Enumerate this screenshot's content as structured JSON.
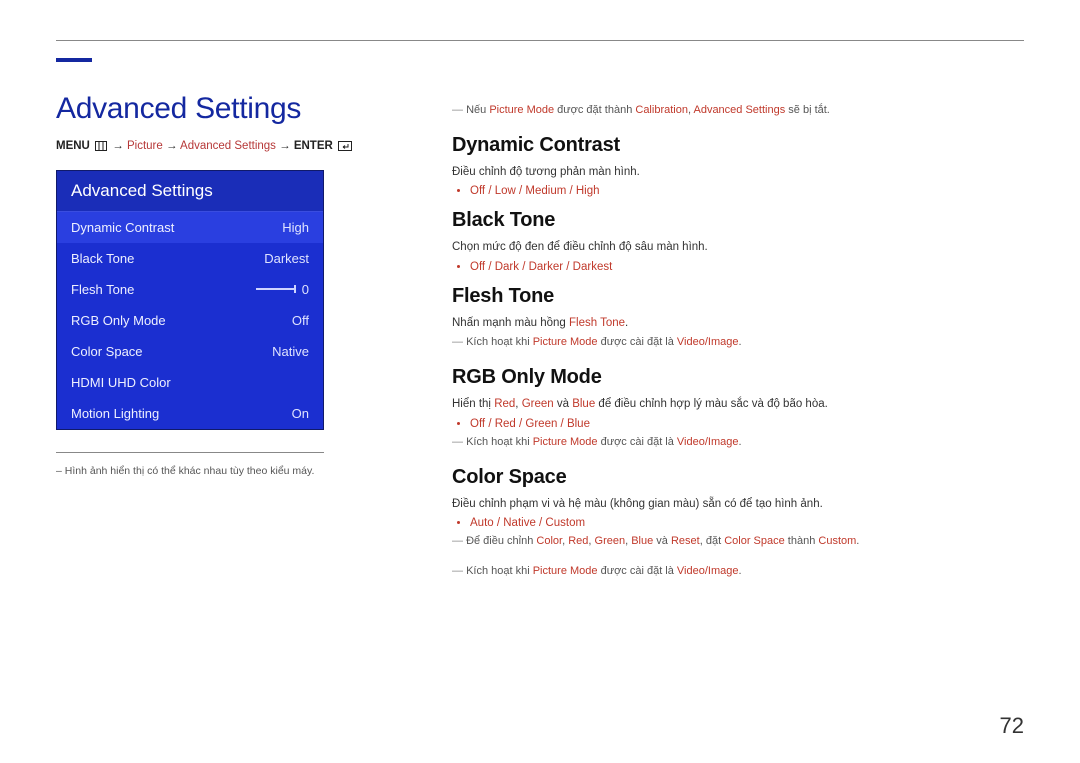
{
  "page_number": "72",
  "page_title": "Advanced Settings",
  "breadcrumb": {
    "prefix": "MENU",
    "picture": "Picture",
    "advanced": "Advanced Settings",
    "enter": "ENTER"
  },
  "menu": {
    "title": "Advanced Settings",
    "rows": [
      {
        "label": "Dynamic Contrast",
        "value": "High",
        "selected": true
      },
      {
        "label": "Black Tone",
        "value": "Darkest"
      },
      {
        "label": "Flesh Tone",
        "value": "0",
        "slider": true
      },
      {
        "label": "RGB Only Mode",
        "value": "Off"
      },
      {
        "label": "Color Space",
        "value": "Native"
      },
      {
        "label": "HDMI UHD Color",
        "value": ""
      },
      {
        "label": "Motion Lighting",
        "value": "On"
      }
    ]
  },
  "caption": "– Hình ảnh hiển thị có thể khác nhau tùy theo kiểu máy.",
  "topnote": {
    "pre": "Nếu ",
    "pm": "Picture Mode",
    "mid": " được đặt thành ",
    "cal": "Calibration",
    "mid2": ", ",
    "as": "Advanced Settings",
    "post": " sẽ bị tắt."
  },
  "sections": {
    "dc": {
      "title": "Dynamic Contrast",
      "desc": "Điều chỉnh độ tương phản màn hình.",
      "opts": "Off / Low / Medium / High"
    },
    "bt": {
      "title": "Black Tone",
      "desc": "Chọn mức độ đen để điều chỉnh độ sâu màn hình.",
      "opts": "Off / Dark / Darker / Darkest"
    },
    "ft": {
      "title": "Flesh Tone",
      "desc_pre": "Nhấn mạnh màu hồng ",
      "desc_hl": "Flesh Tone",
      "desc_post": ".",
      "note_pre": "Kích hoạt khi ",
      "note_pm": "Picture Mode",
      "note_mid": " được cài đặt là ",
      "note_vi": "Video/Image",
      "note_post": "."
    },
    "rgb": {
      "title": "RGB Only Mode",
      "desc_pre": "Hiển thị ",
      "r": "Red",
      "g": "Green",
      "b": "Blue",
      "desc_mid1": ", ",
      "desc_and": " và ",
      "desc_post": " để điều chỉnh hợp lý màu sắc và độ bão hòa.",
      "opts": "Off / Red / Green / Blue",
      "note_pre": "Kích hoạt khi ",
      "note_pm": "Picture Mode",
      "note_mid": " được cài đặt là ",
      "note_vi": "Video/Image",
      "note_post": "."
    },
    "cs": {
      "title": "Color Space",
      "desc": "Điều chỉnh phạm vi và hệ màu (không gian màu) sẵn có để tạo hình ảnh.",
      "opts": "Auto / Native / Custom",
      "n1_pre": "Để điều chỉnh ",
      "n1_color": "Color",
      "n1_r": "Red",
      "n1_g": "Green",
      "n1_b": "Blue",
      "n1_reset": "Reset",
      "n1_mid": ", đặt ",
      "n1_cs": "Color Space",
      "n1_mid2": " thành ",
      "n1_custom": "Custom",
      "n1_post": ".",
      "n2_pre": "Kích hoạt khi ",
      "n2_pm": "Picture Mode",
      "n2_mid": " được cài đặt là ",
      "n2_vi": "Video/Image",
      "n2_post": "."
    }
  }
}
